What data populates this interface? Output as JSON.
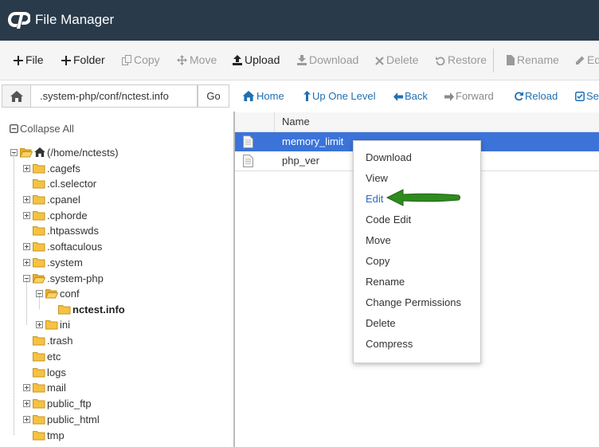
{
  "app": {
    "title": "File Manager"
  },
  "toolbar": {
    "items": [
      {
        "label": "File",
        "icon": "plus-icon",
        "enabled": true
      },
      {
        "label": "Folder",
        "icon": "plus-icon",
        "enabled": true
      },
      {
        "label": "Copy",
        "icon": "copy-icon",
        "enabled": false
      },
      {
        "label": "Move",
        "icon": "move-icon",
        "enabled": false
      },
      {
        "label": "Upload",
        "icon": "upload-icon",
        "enabled": true
      },
      {
        "label": "Download",
        "icon": "download-icon",
        "enabled": false
      },
      {
        "label": "Delete",
        "icon": "times-icon",
        "enabled": false
      },
      {
        "label": "Restore",
        "icon": "undo-icon",
        "enabled": false
      },
      {
        "label": "Rename",
        "icon": "file-icon",
        "enabled": false
      },
      {
        "label": "Edi",
        "icon": "pencil-icon",
        "enabled": false
      }
    ]
  },
  "pathbar": {
    "path": ".system-php/conf/nctest.info",
    "go_label": "Go"
  },
  "nav": {
    "home": "Home",
    "up": "Up One Level",
    "back": "Back",
    "forward": "Forward",
    "reload": "Reload",
    "select": "Se"
  },
  "tree": {
    "collapse_label": "Collapse All",
    "root_label": "(/home/nctests)",
    "items": [
      {
        "label": ".cagefs"
      },
      {
        "label": ".cl.selector"
      },
      {
        "label": ".cpanel"
      },
      {
        "label": ".cphorde"
      },
      {
        "label": ".htpasswds"
      },
      {
        "label": ".softaculous"
      },
      {
        "label": ".system"
      },
      {
        "label": ".system-php"
      },
      {
        "label": "conf"
      },
      {
        "label": "nctest.info"
      },
      {
        "label": "ini"
      },
      {
        "label": ".trash"
      },
      {
        "label": "etc"
      },
      {
        "label": "logs"
      },
      {
        "label": "mail"
      },
      {
        "label": "public_ftp"
      },
      {
        "label": "public_html"
      },
      {
        "label": "tmp"
      }
    ]
  },
  "file_list": {
    "column_name": "Name",
    "rows": [
      {
        "name": "memory_limit",
        "selected": true
      },
      {
        "name": "php_ver",
        "selected": false
      }
    ]
  },
  "context_menu": {
    "items": [
      {
        "label": "Download"
      },
      {
        "label": "View"
      },
      {
        "label": "Edit",
        "highlighted": true
      },
      {
        "label": "Code Edit"
      },
      {
        "label": "Move"
      },
      {
        "label": "Copy"
      },
      {
        "label": "Rename"
      },
      {
        "label": "Change Permissions"
      },
      {
        "label": "Delete"
      },
      {
        "label": "Compress"
      }
    ]
  },
  "colors": {
    "header_bg": "#293a4a",
    "link_blue": "#1f6fb2",
    "selection_blue": "#3b73d9",
    "folder_yellow": "#f5c242",
    "arrow_green": "#2f8a1f"
  }
}
